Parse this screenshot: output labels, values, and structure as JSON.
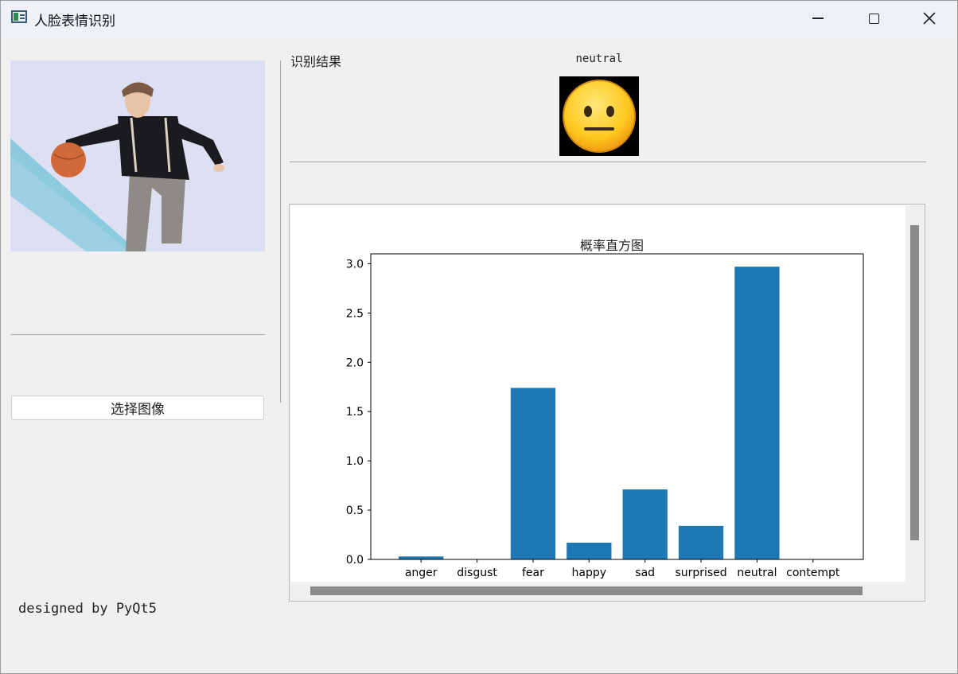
{
  "window": {
    "title": "人脸表情识别"
  },
  "left_panel": {
    "image_alt": "person dribbling a basketball",
    "select_button_label": "选择图像",
    "footer_text": "designed by PyQt5"
  },
  "result": {
    "label": "识别结果",
    "emotion": "neutral",
    "emoji": "neutral-face-emoji"
  },
  "chart_data": {
    "type": "bar",
    "title": "概率直方图",
    "categories": [
      "anger",
      "disgust",
      "fear",
      "happy",
      "sad",
      "surprised",
      "neutral",
      "contempt"
    ],
    "values": [
      0.03,
      0.0,
      1.74,
      0.17,
      0.71,
      0.34,
      2.97,
      0.0
    ],
    "ylim": [
      0,
      3.1
    ],
    "yticks": [
      "0.0",
      "0.5",
      "1.0",
      "1.5",
      "2.0",
      "2.5",
      "3.0"
    ],
    "bar_color": "#1f77b4"
  },
  "colors": {
    "background": "#f0f0f0",
    "titlebar": "#eef2f7",
    "bar": "#1f77b4",
    "scrollbar": "#8a8a8a"
  }
}
